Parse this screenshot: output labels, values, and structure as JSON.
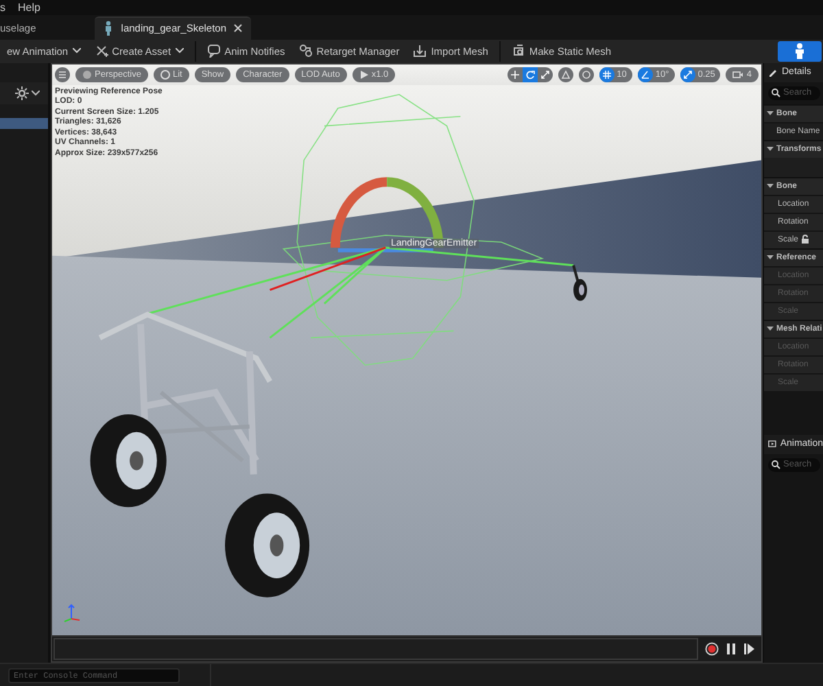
{
  "menu": [
    "s",
    "Help"
  ],
  "tabs": [
    {
      "label": "uselage",
      "selected": false
    },
    {
      "label": "landing_gear_Skeleton",
      "selected": true
    }
  ],
  "toolbar": [
    {
      "label": "ew Animation",
      "dropdown": true
    },
    {
      "label": "Create Asset",
      "dropdown": true
    },
    {
      "label": "Anim Notifies",
      "dropdown": false
    },
    {
      "label": "Retarget Manager",
      "dropdown": false
    },
    {
      "label": "Import Mesh",
      "dropdown": false
    },
    {
      "label": "Make Static Mesh",
      "dropdown": false
    }
  ],
  "left_panel": {
    "rows": [
      {
        "selected": true
      }
    ]
  },
  "viewport": {
    "pills": [
      "Perspective",
      "Lit",
      "Show",
      "Character",
      "LOD Auto",
      "x1.0"
    ],
    "transform_tools": [
      {
        "selected": false
      },
      {
        "selected": true
      },
      {
        "selected": false
      }
    ],
    "snaps": [
      {
        "value": "10",
        "on": true
      },
      {
        "value": "10°",
        "on": true
      },
      {
        "value": "0.25",
        "on": true
      }
    ],
    "camera_speed": "4",
    "stats": [
      "Previewing Reference Pose",
      "LOD: 0",
      "Current Screen Size: 1.205",
      "Triangles: 31,626",
      "Vertices: 38,643",
      "UV Channels: 1",
      "Approx Size: 239x577x256"
    ],
    "bone_label": "LandingGearEmitter",
    "recording": true
  },
  "details": {
    "title": "Details",
    "search": {
      "placeholder": "Search"
    },
    "sections": [
      {
        "title": "Bone",
        "expanded": true,
        "rows": [
          {
            "label": "Bone Name",
            "disabled": false
          }
        ]
      },
      {
        "title": "Transforms",
        "expanded": true,
        "children": [
          {
            "title": "Bone",
            "expanded": true,
            "rows": [
              {
                "label": "Location",
                "disabled": false,
                "lock": false
              },
              {
                "label": "Rotation",
                "disabled": false,
                "lock": false
              },
              {
                "label": "Scale",
                "disabled": false,
                "lock": true
              }
            ]
          },
          {
            "title": "Reference",
            "expanded": true,
            "rows": [
              {
                "label": "Location",
                "disabled": true,
                "lock": false
              },
              {
                "label": "Rotation",
                "disabled": true,
                "lock": false
              },
              {
                "label": "Scale",
                "disabled": true,
                "lock": false
              }
            ]
          },
          {
            "title": "Mesh Relati",
            "expanded": true,
            "rows": [
              {
                "label": "Location",
                "disabled": true,
                "lock": false
              },
              {
                "label": "Rotation",
                "disabled": true,
                "lock": false
              },
              {
                "label": "Scale",
                "disabled": true,
                "lock": false
              }
            ]
          }
        ]
      }
    ]
  },
  "animation": {
    "title": "Animation",
    "search": {
      "placeholder": "Search"
    }
  },
  "console": {
    "placeholder": "Enter Console Command"
  }
}
